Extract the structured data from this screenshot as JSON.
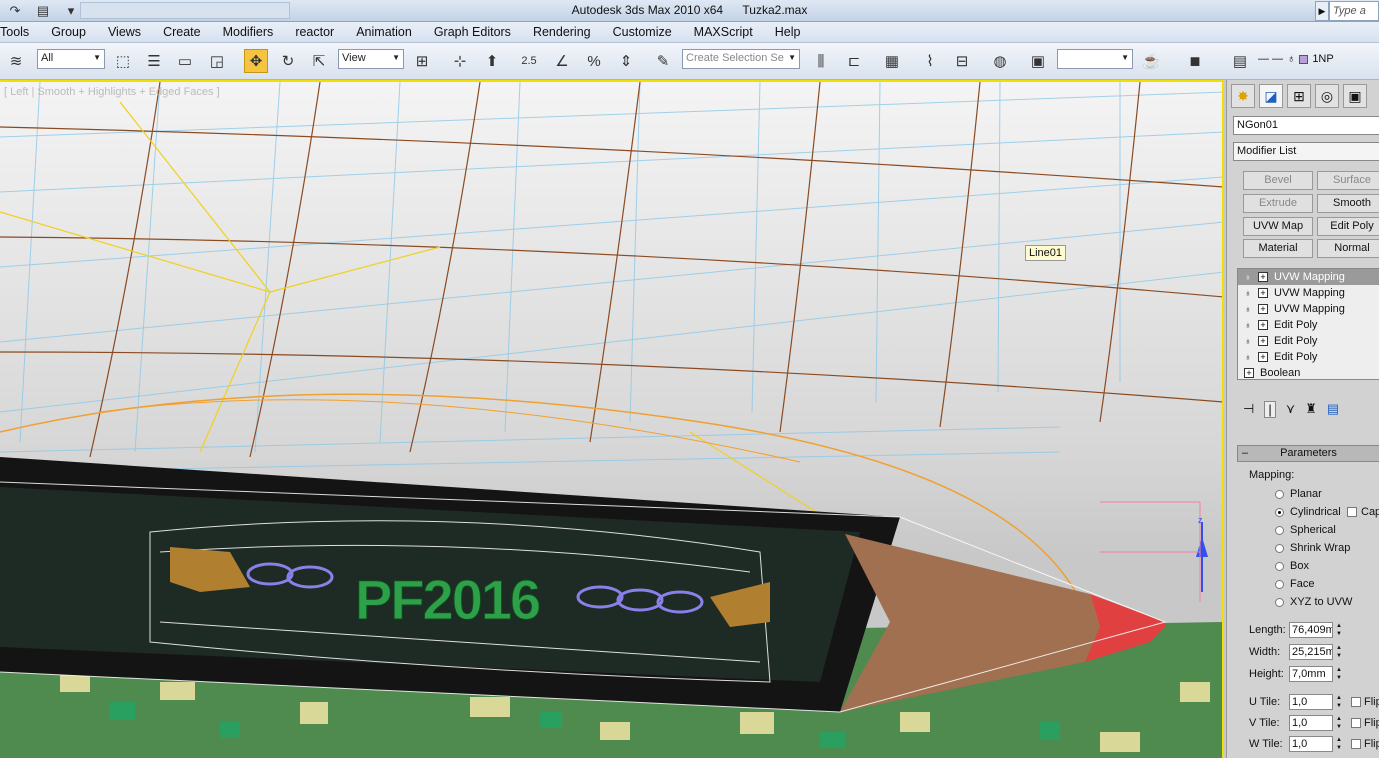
{
  "titlebar": {
    "app": "Autodesk 3ds Max  2010 x64",
    "file": "Tuzka2.max",
    "search_placeholder": "Type a"
  },
  "menu": [
    "Tools",
    "Group",
    "Views",
    "Create",
    "Modifiers",
    "reactor",
    "Animation",
    "Graph Editors",
    "Rendering",
    "Customize",
    "MAXScript",
    "Help"
  ],
  "toolbar": {
    "filter": "All",
    "ref_coord": "View",
    "snap_angle": "2.5",
    "selection_set_placeholder": "Create Selection Se",
    "named_set": "",
    "layer_label": "1NP"
  },
  "viewport": {
    "label": "[ Left | Smooth + Highlights + Edged Faces ]",
    "object_tooltip": "Line01",
    "model_text": "PF2016",
    "gizmo_axis": "z"
  },
  "command_panel": {
    "object_name": "NGon01",
    "modifier_list": "Modifier List",
    "modifier_buttons": [
      {
        "label": "Bevel",
        "enabled": false
      },
      {
        "label": "Surface",
        "enabled": false
      },
      {
        "label": "Extrude",
        "enabled": false
      },
      {
        "label": "Smooth",
        "enabled": true
      },
      {
        "label": "UVW Map",
        "enabled": true
      },
      {
        "label": "Edit Poly",
        "enabled": true
      },
      {
        "label": "Material",
        "enabled": true
      },
      {
        "label": "Normal",
        "enabled": true
      }
    ],
    "stack": [
      {
        "label": "UVW Mapping",
        "selected": true
      },
      {
        "label": "UVW Mapping",
        "selected": false
      },
      {
        "label": "UVW Mapping",
        "selected": false
      },
      {
        "label": "Edit Poly",
        "selected": false
      },
      {
        "label": "Edit Poly",
        "selected": false
      },
      {
        "label": "Edit Poly",
        "selected": false
      },
      {
        "label": "Boolean",
        "selected": false
      }
    ],
    "parameters": {
      "title": "Parameters",
      "mapping_label": "Mapping:",
      "mapping_options": [
        "Planar",
        "Cylindrical",
        "Spherical",
        "Shrink Wrap",
        "Box",
        "Face",
        "XYZ to UVW"
      ],
      "mapping_selected": "Cylindrical",
      "cap_label": "Cap",
      "length_label": "Length:",
      "length_value": "76,409m",
      "width_label": "Width:",
      "width_value": "25,215m",
      "height_label": "Height:",
      "height_value": "7,0mm",
      "u_tile_label": "U Tile:",
      "u_tile_value": "1,0",
      "v_tile_label": "V Tile:",
      "v_tile_value": "1,0",
      "w_tile_label": "W Tile:",
      "w_tile_value": "1,0",
      "flip_label": "Flip"
    }
  }
}
